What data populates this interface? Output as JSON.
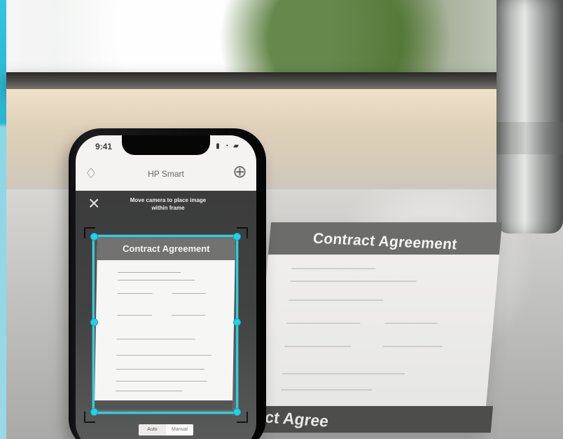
{
  "phone": {
    "time": "9:41",
    "app_title": "HP Smart",
    "instruction": "Move camera to place image within frame",
    "document_title": "Contract Agreement",
    "modes": [
      "Auto",
      "Manual"
    ]
  },
  "background_document": {
    "title": "Contract Agreement",
    "footer_text": "act Agree"
  }
}
